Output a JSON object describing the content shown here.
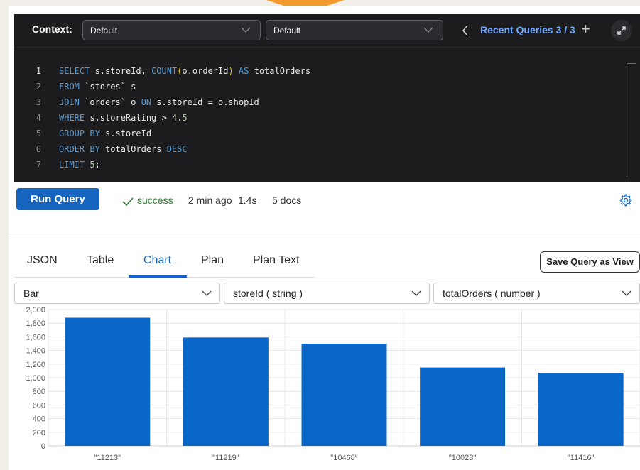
{
  "context_bar": {
    "label": "Context:",
    "select1": "Default",
    "select2": "Default",
    "recent_queries": "Recent Queries 3 / 3"
  },
  "editor": {
    "lines": [
      {
        "n": "1",
        "html": "<span class='kw'>SELECT</span> s.storeId, <span class='kw'>COUNT</span><span class='paren'>(</span>o.orderId<span class='paren'>)</span> <span class='kw'>AS</span> totalOrders"
      },
      {
        "n": "2",
        "html": "<span class='kw'>FROM</span> `stores` s"
      },
      {
        "n": "3",
        "html": "<span class='kw'>JOIN</span> `orders` o <span class='kw'>ON</span> s.storeId = o.shopId"
      },
      {
        "n": "4",
        "html": "<span class='kw'>WHERE</span> s.storeRating &gt; <span class='num'>4.5</span>"
      },
      {
        "n": "5",
        "html": "<span class='kw'>GROUP BY</span> s.storeId"
      },
      {
        "n": "6",
        "html": "<span class='kw'>ORDER BY</span> totalOrders <span class='kw'>DESC</span>"
      },
      {
        "n": "7",
        "html": "<span class='kw'>LIMIT</span> <span class='num'>5</span>;"
      }
    ]
  },
  "run": {
    "button": "Run Query",
    "status": "success",
    "time_ago": "2 min ago",
    "duration": "1.4s",
    "docs": "5 docs"
  },
  "tabs": [
    "JSON",
    "Table",
    "Chart",
    "Plan",
    "Plan Text"
  ],
  "active_tab": "Chart",
  "save_view_label": "Save Query as View",
  "chart_controls": {
    "type": "Bar",
    "x_field": "storeId ( string )",
    "y_field": "totalOrders ( number )"
  },
  "colors": {
    "accent": "#1565c0",
    "bar": "#0a66c8",
    "success": "#2e7d32"
  },
  "chart_data": {
    "type": "bar",
    "categories": [
      "\"11213\"",
      "\"11219\"",
      "\"10468\"",
      "\"10023\"",
      "\"11416\""
    ],
    "values": [
      1880,
      1590,
      1500,
      1150,
      1070
    ],
    "ylim": [
      0,
      2000
    ],
    "yticks": [
      "0",
      "200",
      "400",
      "600",
      "800",
      "1,000",
      "1,200",
      "1,400",
      "1,600",
      "1,800",
      "2,000"
    ],
    "grid": true
  }
}
